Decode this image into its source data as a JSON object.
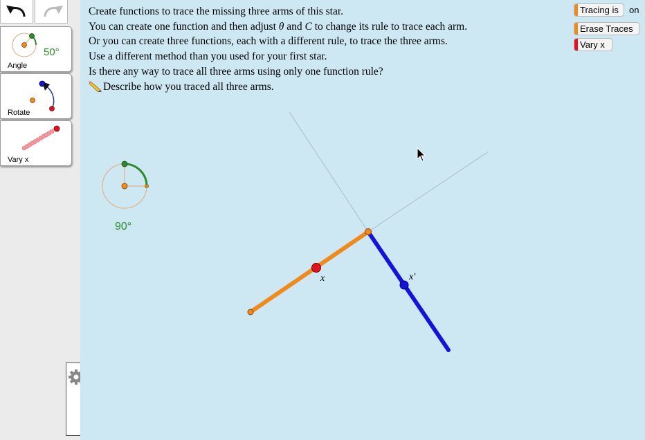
{
  "toolbar": {
    "undo_icon": "undo-arrow-icon",
    "redo_icon": "redo-arrow-icon"
  },
  "tools": [
    {
      "label": "Angle",
      "value": "50°"
    },
    {
      "label": "Rotate"
    },
    {
      "label": "Vary x"
    }
  ],
  "instructions": {
    "line1": "Create functions to trace the missing three arms of this star.",
    "line2_a": "You can create one function and then adjust ",
    "line2_theta": "θ",
    "line2_b": " and ",
    "line2_c": "C",
    "line2_d": " to change its rule to trace each arm.",
    "line3": "Or you can create three functions, each with a different rule, to trace the three arms.",
    "line4": "Use a different method than you used for your first star.",
    "line5": "Is there any way to trace all three arms using only one function rule?",
    "line6": "Describe how you traced all three arms."
  },
  "buttons": {
    "tracing": "Tracing is",
    "tracing_state": "on",
    "erase": "Erase Traces",
    "vary": "Vary x"
  },
  "canvas": {
    "angle_dial_value": "90°",
    "point_x_label": "x",
    "point_xprime_label": "x′"
  },
  "colors": {
    "background": "#cde8f3",
    "arm_original": "#f08a1c",
    "arm_image": "#1414d8",
    "point_x": "#e0141e",
    "angle_green": "#2d8a2d"
  },
  "icons": {
    "gear": "gear-icon",
    "cursor": "mouse-pointer-icon",
    "pencil": "pencil-icon"
  }
}
